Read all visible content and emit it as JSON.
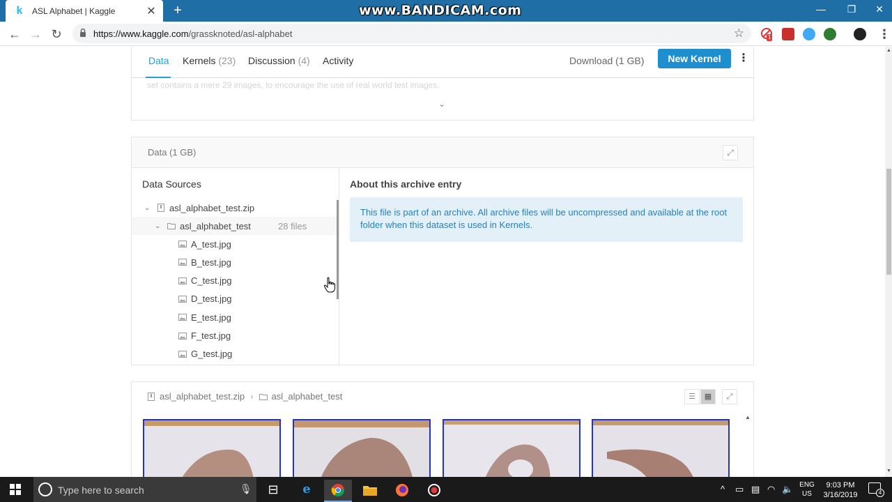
{
  "browser": {
    "tab_title": "ASL Alphabet | Kaggle",
    "tab_favicon": "k",
    "new_tab_label": "+",
    "watermark": "www.BANDICAM.com",
    "url_prefix": "https://www.kaggle.com",
    "url_path": "/grassknoted/asl-alphabet",
    "icons": {
      "back": "back-arrow-icon",
      "forward": "forward-arrow-icon",
      "reload": "reload-icon",
      "bookmark": "star-icon",
      "menu": "kebab-menu-icon"
    },
    "extension_badge": "1"
  },
  "kaggle_nav": {
    "tabs": [
      {
        "label": "Data",
        "count": ""
      },
      {
        "label": "Kernels",
        "count": "(23)"
      },
      {
        "label": "Discussion",
        "count": "(4)"
      },
      {
        "label": "Activity",
        "count": ""
      }
    ],
    "download": "Download (1 GB)",
    "new_kernel": "New Kernel",
    "faded_text": "set contains a mere 29 images, to encourage the use of real world test images."
  },
  "data_panel": {
    "title": "Data (1 GB)",
    "sources_title": "Data Sources",
    "tree": {
      "zip": "asl_alphabet_test.zip",
      "folder": "asl_alphabet_test",
      "folder_count": "28 files",
      "files": [
        "A_test.jpg",
        "B_test.jpg",
        "C_test.jpg",
        "D_test.jpg",
        "E_test.jpg",
        "F_test.jpg",
        "G_test.jpg"
      ]
    },
    "about_title": "About this archive entry",
    "about_text": "This file is part of an archive. All archive files will be uncompressed and available at the root folder when this dataset is used in Kernels."
  },
  "browser_panel": {
    "breadcrumb": [
      "asl_alphabet_test.zip",
      "asl_alphabet_test"
    ],
    "separator": "›"
  },
  "taskbar": {
    "search_placeholder": "Type here to search",
    "lang_line1": "ENG",
    "lang_line2": "US",
    "time": "9:03 PM",
    "date": "3/16/2019",
    "notification_count": "4"
  },
  "colors": {
    "accent_blue": "#20a0d8",
    "new_kernel_button": "#1f8ecf",
    "titlebar": "#1f6ea5",
    "info_box_bg": "#e3f0f8",
    "thumbnail_border": "#2233cc"
  }
}
